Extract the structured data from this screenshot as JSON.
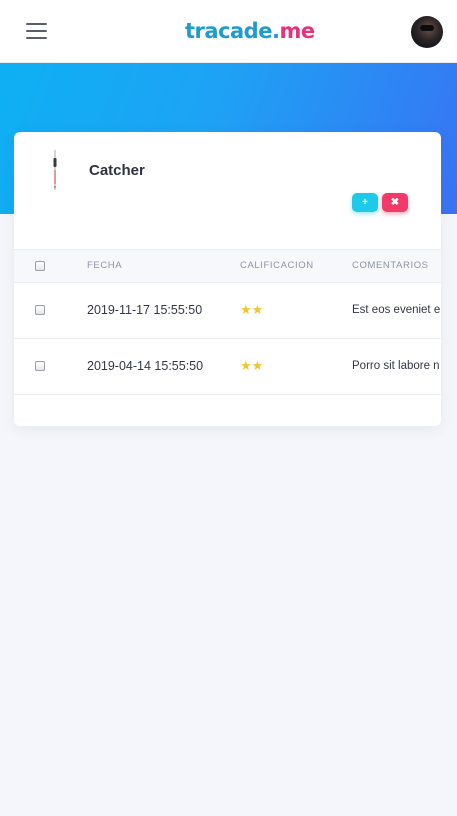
{
  "header": {
    "logo_part1": "tracade.",
    "logo_part2": "me",
    "avatar_icon": "user-avatar"
  },
  "product": {
    "title": "Catcher",
    "image_icon": "catcher-image",
    "add_label": "+",
    "remove_label": "✖"
  },
  "table": {
    "columns": [
      "FECHA",
      "CALIFICACION",
      "COMENTARIOS"
    ],
    "rows": [
      {
        "date": "2019-11-17 15:55:50",
        "stars": "★★",
        "comment": "Est eos eveniet e"
      },
      {
        "date": "2019-04-14 15:55:50",
        "stars": "★★",
        "comment": "Porro sit labore n"
      }
    ]
  },
  "colors": {
    "brand_blue": "#1f9bd0",
    "brand_pink": "#e8317a",
    "hero_start": "#0eb0f3",
    "hero_end": "#3873f3",
    "add_button": "#1ec9e9",
    "remove_button": "#f13a67",
    "star": "#f2c624"
  }
}
